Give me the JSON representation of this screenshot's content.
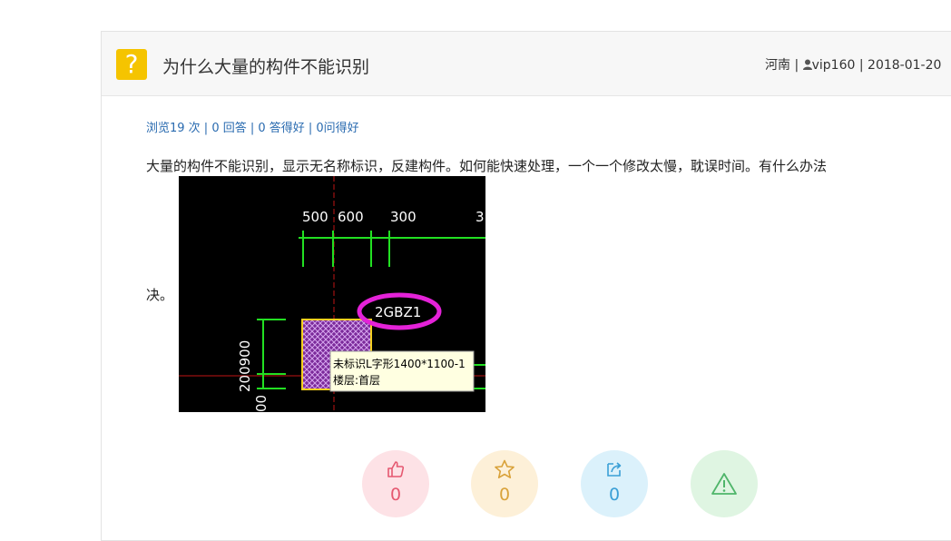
{
  "question": {
    "icon": "question-icon",
    "icon_glyph": "?",
    "title": "为什么大量的构件不能识别",
    "meta_region": "河南 |",
    "meta_user": "vip160",
    "meta_date": "| 2018-01-20",
    "stats": "浏览19 次 | 0 回答 | 0 答得好 | 0问得好",
    "body_text": "大量的构件不能识别，显示无名称标识，反建构件。如何能快速处理，一个一个修改太慢，耽误时间。有什么办法",
    "body_tail": "决。"
  },
  "screenshot": {
    "dims": [
      "500",
      "600",
      "300",
      "3"
    ],
    "label": "2GBZ1",
    "vertical_dims": "200900",
    "vertical_tail": "00",
    "tooltip_line1": "未标识L字形1400*1100-1",
    "tooltip_line2": "楼层:首层"
  },
  "actions": {
    "like_count": "0",
    "favorite_count": "0",
    "share_count": "0"
  },
  "colors": {
    "accent_link": "#2a6bb0",
    "question_icon": "#f5c400",
    "like": "#e55870",
    "favorite": "#d9a23a",
    "share": "#3a9fd6",
    "report": "#4fb56a"
  }
}
